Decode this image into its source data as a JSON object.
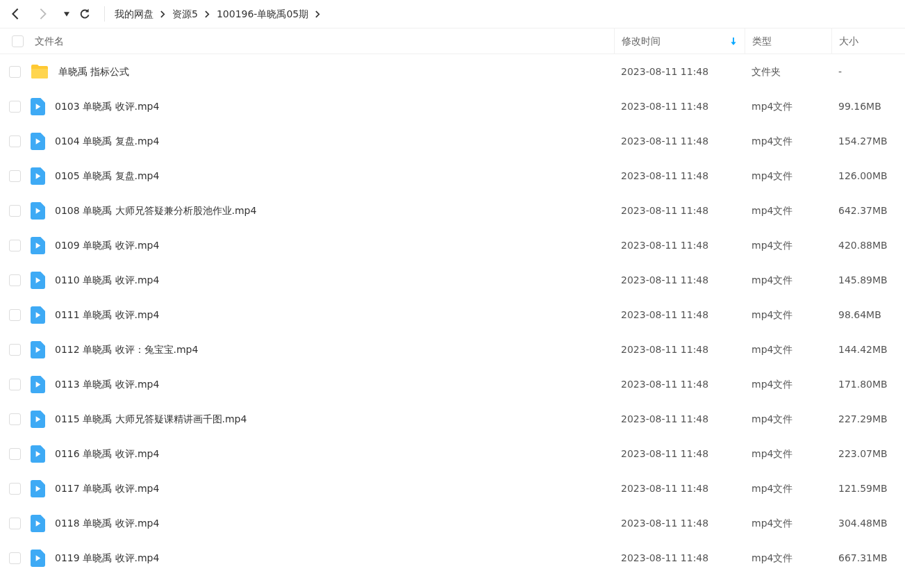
{
  "breadcrumb": [
    "我的网盘",
    "资源5",
    "100196-单晓禹05期"
  ],
  "table": {
    "columns": [
      {
        "label": "文件名",
        "sorted": false
      },
      {
        "label": "修改时间",
        "sorted": true
      },
      {
        "label": "类型",
        "sorted": false
      },
      {
        "label": "大小",
        "sorted": false
      }
    ],
    "all_checked": false,
    "rows": [
      {
        "kind": "folder",
        "name": "单晓禹 指标公式",
        "modified": "2023-08-11 11:48",
        "type": "文件夹",
        "size": "-",
        "checked": false
      },
      {
        "kind": "video",
        "name": "0103 单晓禹 收评.mp4",
        "modified": "2023-08-11 11:48",
        "type": "mp4文件",
        "size": "99.16MB",
        "checked": false
      },
      {
        "kind": "video",
        "name": "0104 单晓禹 复盘.mp4",
        "modified": "2023-08-11 11:48",
        "type": "mp4文件",
        "size": "154.27MB",
        "checked": false
      },
      {
        "kind": "video",
        "name": "0105 单晓禹 复盘.mp4",
        "modified": "2023-08-11 11:48",
        "type": "mp4文件",
        "size": "126.00MB",
        "checked": false
      },
      {
        "kind": "video",
        "name": "0108 单晓禹 大师兄答疑兼分析股池作业.mp4",
        "modified": "2023-08-11 11:48",
        "type": "mp4文件",
        "size": "642.37MB",
        "checked": false
      },
      {
        "kind": "video",
        "name": "0109 单晓禹 收评.mp4",
        "modified": "2023-08-11 11:48",
        "type": "mp4文件",
        "size": "420.88MB",
        "checked": false
      },
      {
        "kind": "video",
        "name": "0110 单晓禹 收评.mp4",
        "modified": "2023-08-11 11:48",
        "type": "mp4文件",
        "size": "145.89MB",
        "checked": false
      },
      {
        "kind": "video",
        "name": "0111 单晓禹 收评.mp4",
        "modified": "2023-08-11 11:48",
        "type": "mp4文件",
        "size": "98.64MB",
        "checked": false
      },
      {
        "kind": "video",
        "name": "0112 单晓禹 收评：兔宝宝.mp4",
        "modified": "2023-08-11 11:48",
        "type": "mp4文件",
        "size": "144.42MB",
        "checked": false
      },
      {
        "kind": "video",
        "name": "0113 单晓禹 收评.mp4",
        "modified": "2023-08-11 11:48",
        "type": "mp4文件",
        "size": "171.80MB",
        "checked": false
      },
      {
        "kind": "video",
        "name": "0115 单晓禹 大师兄答疑课精讲画千图.mp4",
        "modified": "2023-08-11 11:48",
        "type": "mp4文件",
        "size": "227.29MB",
        "checked": false
      },
      {
        "kind": "video",
        "name": "0116 单晓禹 收评.mp4",
        "modified": "2023-08-11 11:48",
        "type": "mp4文件",
        "size": "223.07MB",
        "checked": false
      },
      {
        "kind": "video",
        "name": "0117 单晓禹 收评.mp4",
        "modified": "2023-08-11 11:48",
        "type": "mp4文件",
        "size": "121.59MB",
        "checked": false
      },
      {
        "kind": "video",
        "name": "0118 单晓禹 收评.mp4",
        "modified": "2023-08-11 11:48",
        "type": "mp4文件",
        "size": "304.48MB",
        "checked": false
      },
      {
        "kind": "video",
        "name": "0119 单晓禹 收评.mp4",
        "modified": "2023-08-11 11:48",
        "type": "mp4文件",
        "size": "667.31MB",
        "checked": false
      }
    ]
  }
}
